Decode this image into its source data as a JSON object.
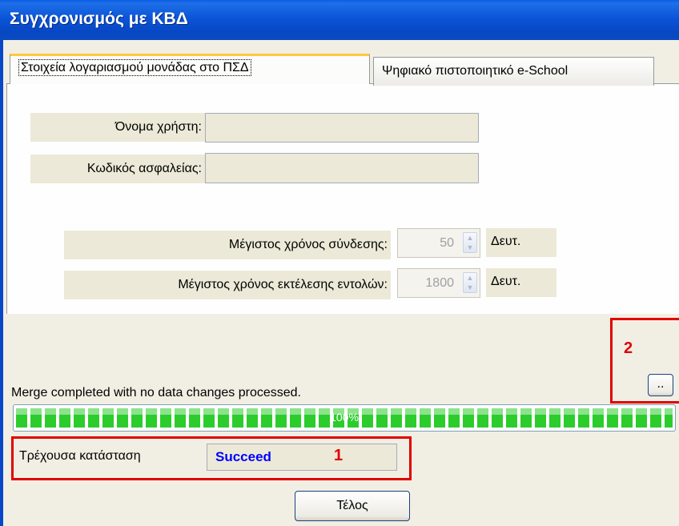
{
  "window": {
    "title": "Συγχρονισμός με ΚΒΔ"
  },
  "tabs": [
    {
      "label": "Στοιχεία λογαριασμού μονάδας στο ΠΣΔ"
    },
    {
      "label": "Ψηφιακό πιστοποιητικό e-School"
    }
  ],
  "account": {
    "username_label": "Όνομα χρήστη:",
    "username_value": "",
    "password_label": "Κωδικός ασφαλείας:",
    "password_value": ""
  },
  "timeouts": {
    "connect_label": "Μέγιστος χρόνος σύνδεσης:",
    "connect_value": "50",
    "connect_unit": "Δευτ.",
    "exec_label": "Μέγιστος χρόνος εκτέλεσης εντολών:",
    "exec_value": "1800",
    "exec_unit": "Δευτ."
  },
  "progress": {
    "message": "Merge completed with no data changes processed.",
    "percent_text": "100%",
    "fraction": 1.0,
    "details_button": ".."
  },
  "status": {
    "label": "Τρέχουσα κατάσταση",
    "value": "Succeed",
    "value_color": "#0000ff"
  },
  "annotations": {
    "n1": "1",
    "n2": "2",
    "color": "#e00000"
  },
  "buttons": {
    "close": "Τέλος"
  }
}
